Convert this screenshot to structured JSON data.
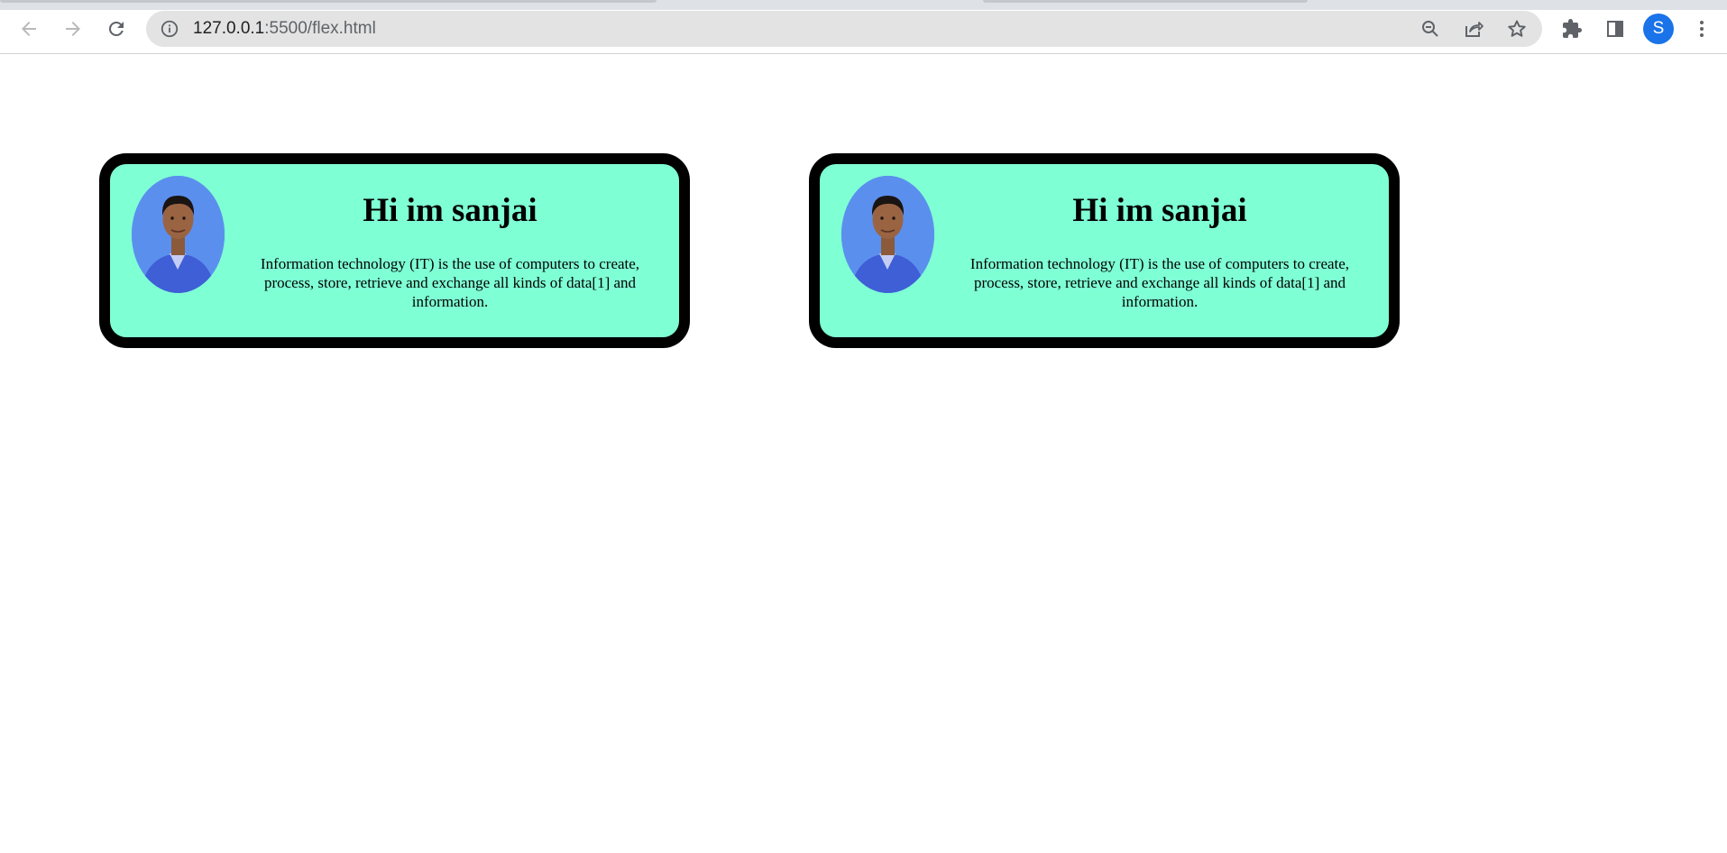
{
  "browser": {
    "url_host": "127.0.0.1",
    "url_rest": ":5500/flex.html",
    "profile_initial": "S"
  },
  "cards": [
    {
      "heading": "Hi im sanjai",
      "description": "Information technology (IT) is the use of computers to create, process, store, retrieve and exchange all kinds of data[1] and information."
    },
    {
      "heading": "Hi im sanjai",
      "description": "Information technology (IT) is the use of computers to create, process, store, retrieve and exchange all kinds of data[1] and information."
    }
  ],
  "colors": {
    "card_background": "#7fffd4",
    "card_border": "#000000",
    "photo_background": "#5b8fee",
    "profile_avatar": "#1a73e8"
  },
  "icons": {
    "back": "arrow-left-icon",
    "forward": "arrow-right-icon",
    "reload": "reload-icon",
    "site_info": "info-icon",
    "zoom": "zoom-out-icon",
    "share": "share-icon",
    "bookmark": "star-icon",
    "extensions": "puzzle-icon",
    "side_panel": "side-panel-icon",
    "menu": "kebab-menu-icon"
  }
}
